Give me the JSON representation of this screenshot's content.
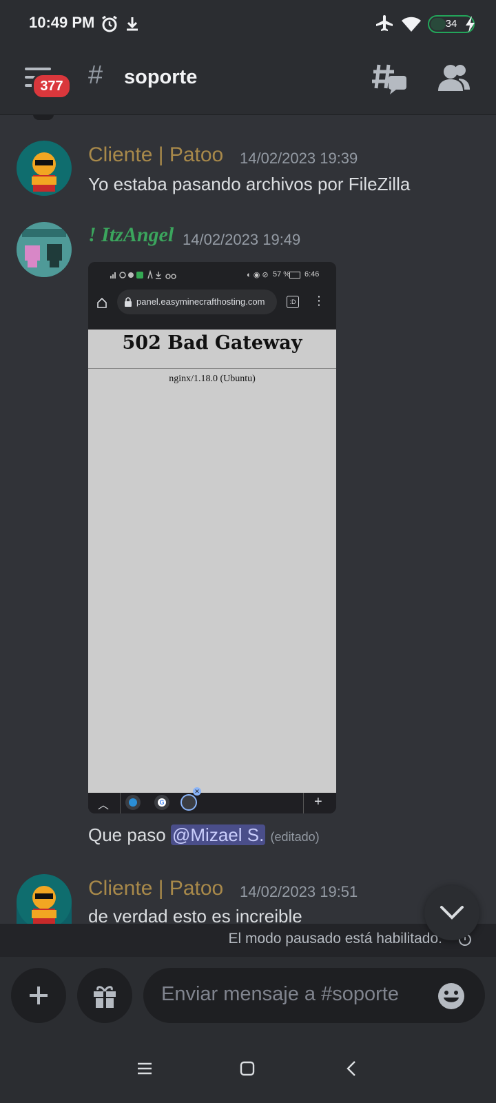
{
  "status_bar": {
    "time": "10:49 PM",
    "battery": "34",
    "battery_level": 0.34
  },
  "header": {
    "unread_badge": "377",
    "channel_hash": "#",
    "channel_name": "soporte"
  },
  "messages": [
    {
      "author": "Cliente | Patoo",
      "author_color": "#a8894a",
      "timestamp": "14/02/2023 19:39",
      "text": "Yo estaba pasando archivos por FileZilla"
    },
    {
      "author": "! ItzAngel",
      "author_color": "#3ba55d",
      "timestamp": "14/02/2023 19:49",
      "attachment": {
        "status_battery": "57 %",
        "status_time": "6:46",
        "url": "panel.easyminecrafthosting.com",
        "tab_count": ":D",
        "heading": "502 Bad Gateway",
        "server": "nginx/1.18.0 (Ubuntu)"
      },
      "text_before": "Que paso ",
      "mention": "@Mizael S.",
      "edited": "(editado)"
    },
    {
      "author": "Cliente | Patoo",
      "author_color": "#a8894a",
      "timestamp": "14/02/2023 19:51",
      "text": "de verdad esto es increible"
    }
  ],
  "paused_notice": "El modo pausado está habilitado.",
  "composer": {
    "placeholder": "Enviar mensaje a #soporte"
  }
}
